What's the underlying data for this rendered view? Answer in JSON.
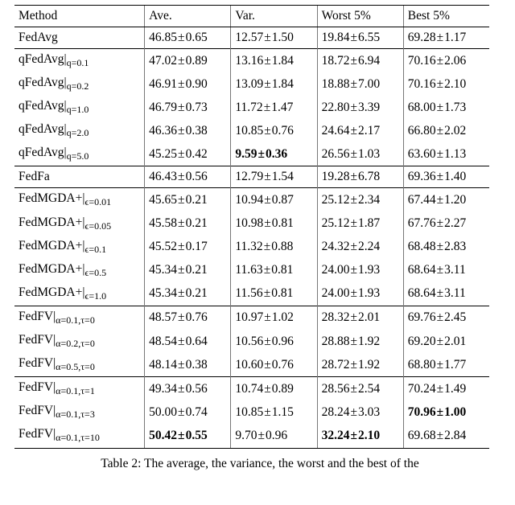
{
  "table": {
    "header": {
      "method": "Method",
      "ave": "Ave.",
      "var": "Var.",
      "worst": "Worst 5%",
      "best": "Best 5%"
    },
    "pm": "±",
    "rows": [
      {
        "method": "FedAvg",
        "sub": "",
        "ave_v": "46.85",
        "ave_e": "0.65",
        "var_v": "12.57",
        "var_e": "1.50",
        "wor_v": "19.84",
        "wor_e": "6.55",
        "bes_v": "69.28",
        "bes_e": "1.17",
        "group": "a",
        "b": []
      },
      {
        "method": "qFedAvg|",
        "sub": "q=0.1",
        "ave_v": "47.02",
        "ave_e": "0.89",
        "var_v": "13.16",
        "var_e": "1.84",
        "wor_v": "18.72",
        "wor_e": "6.94",
        "bes_v": "70.16",
        "bes_e": "2.06",
        "group": "b",
        "b": []
      },
      {
        "method": "qFedAvg|",
        "sub": "q=0.2",
        "ave_v": "46.91",
        "ave_e": "0.90",
        "var_v": "13.09",
        "var_e": "1.84",
        "wor_v": "18.88",
        "wor_e": "7.00",
        "bes_v": "70.16",
        "bes_e": "2.10",
        "group": "b",
        "b": []
      },
      {
        "method": "qFedAvg|",
        "sub": "q=1.0",
        "ave_v": "46.79",
        "ave_e": "0.73",
        "var_v": "11.72",
        "var_e": "1.47",
        "wor_v": "22.80",
        "wor_e": "3.39",
        "bes_v": "68.00",
        "bes_e": "1.73",
        "group": "b",
        "b": []
      },
      {
        "method": "qFedAvg|",
        "sub": "q=2.0",
        "ave_v": "46.36",
        "ave_e": "0.38",
        "var_v": "10.85",
        "var_e": "0.76",
        "wor_v": "24.64",
        "wor_e": "2.17",
        "bes_v": "66.80",
        "bes_e": "2.02",
        "group": "b",
        "b": []
      },
      {
        "method": "qFedAvg|",
        "sub": "q=5.0",
        "ave_v": "45.25",
        "ave_e": "0.42",
        "var_v": "9.59",
        "var_e": "0.36",
        "wor_v": "26.56",
        "wor_e": "1.03",
        "bes_v": "63.60",
        "bes_e": "1.13",
        "group": "b",
        "b": [
          "var"
        ]
      },
      {
        "method": "FedFa",
        "sub": "",
        "ave_v": "46.43",
        "ave_e": "0.56",
        "var_v": "12.79",
        "var_e": "1.54",
        "wor_v": "19.28",
        "wor_e": "6.78",
        "bes_v": "69.36",
        "bes_e": "1.40",
        "group": "c",
        "b": []
      },
      {
        "method": "FedMGDA+|",
        "sub": "ϵ=0.01",
        "ave_v": "45.65",
        "ave_e": "0.21",
        "var_v": "10.94",
        "var_e": "0.87",
        "wor_v": "25.12",
        "wor_e": "2.34",
        "bes_v": "67.44",
        "bes_e": "1.20",
        "group": "d",
        "b": []
      },
      {
        "method": "FedMGDA+|",
        "sub": "ϵ=0.05",
        "ave_v": "45.58",
        "ave_e": "0.21",
        "var_v": "10.98",
        "var_e": "0.81",
        "wor_v": "25.12",
        "wor_e": "1.87",
        "bes_v": "67.76",
        "bes_e": "2.27",
        "group": "d",
        "b": []
      },
      {
        "method": "FedMGDA+|",
        "sub": "ϵ=0.1",
        "ave_v": "45.52",
        "ave_e": "0.17",
        "var_v": "11.32",
        "var_e": "0.88",
        "wor_v": "24.32",
        "wor_e": "2.24",
        "bes_v": "68.48",
        "bes_e": "2.83",
        "group": "d",
        "b": []
      },
      {
        "method": "FedMGDA+|",
        "sub": "ϵ=0.5",
        "ave_v": "45.34",
        "ave_e": "0.21",
        "var_v": "11.63",
        "var_e": "0.81",
        "wor_v": "24.00",
        "wor_e": "1.93",
        "bes_v": "68.64",
        "bes_e": "3.11",
        "group": "d",
        "b": []
      },
      {
        "method": "FedMGDA+|",
        "sub": "ϵ=1.0",
        "ave_v": "45.34",
        "ave_e": "0.21",
        "var_v": "11.56",
        "var_e": "0.81",
        "wor_v": "24.00",
        "wor_e": "1.93",
        "bes_v": "68.64",
        "bes_e": "3.11",
        "group": "d",
        "b": []
      },
      {
        "method": "FedFV|",
        "sub": "α=0.1,τ=0",
        "ave_v": "48.57",
        "ave_e": "0.76",
        "var_v": "10.97",
        "var_e": "1.02",
        "wor_v": "28.32",
        "wor_e": "2.01",
        "bes_v": "69.76",
        "bes_e": "2.45",
        "group": "e",
        "b": []
      },
      {
        "method": "FedFV|",
        "sub": "α=0.2,τ=0",
        "ave_v": "48.54",
        "ave_e": "0.64",
        "var_v": "10.56",
        "var_e": "0.96",
        "wor_v": "28.88",
        "wor_e": "1.92",
        "bes_v": "69.20",
        "bes_e": "2.01",
        "group": "e",
        "b": []
      },
      {
        "method": "FedFV|",
        "sub": "α=0.5,τ=0",
        "ave_v": "48.14",
        "ave_e": "0.38",
        "var_v": "10.60",
        "var_e": "0.76",
        "wor_v": "28.72",
        "wor_e": "1.92",
        "bes_v": "68.80",
        "bes_e": "1.77",
        "group": "e",
        "b": []
      },
      {
        "method": "FedFV|",
        "sub": "α=0.1,τ=1",
        "ave_v": "49.34",
        "ave_e": "0.56",
        "var_v": "10.74",
        "var_e": "0.89",
        "wor_v": "28.56",
        "wor_e": "2.54",
        "bes_v": "70.24",
        "bes_e": "1.49",
        "group": "f",
        "b": []
      },
      {
        "method": "FedFV|",
        "sub": "α=0.1,τ=3",
        "ave_v": "50.00",
        "ave_e": "0.74",
        "var_v": "10.85",
        "var_e": "1.15",
        "wor_v": "28.24",
        "wor_e": "3.03",
        "bes_v": "70.96",
        "bes_e": "1.00",
        "group": "f",
        "b": [
          "bes"
        ]
      },
      {
        "method": "FedFV|",
        "sub": "α=0.1,τ=10",
        "ave_v": "50.42",
        "ave_e": "0.55",
        "var_v": "9.70",
        "var_e": "0.96",
        "wor_v": "32.24",
        "wor_e": "2.10",
        "bes_v": "69.68",
        "bes_e": "2.84",
        "group": "f",
        "b": [
          "ave",
          "wor"
        ]
      }
    ]
  },
  "caption": "Table 2: The average, the variance, the worst and the best of the",
  "chart_data": {
    "type": "table",
    "columns": [
      "Method",
      "Ave.",
      "Var.",
      "Worst 5%",
      "Best 5%"
    ],
    "data": [
      [
        "FedAvg",
        "46.85±0.65",
        "12.57±1.50",
        "19.84±6.55",
        "69.28±1.17"
      ],
      [
        "qFedAvg|q=0.1",
        "47.02±0.89",
        "13.16±1.84",
        "18.72±6.94",
        "70.16±2.06"
      ],
      [
        "qFedAvg|q=0.2",
        "46.91±0.90",
        "13.09±1.84",
        "18.88±7.00",
        "70.16±2.10"
      ],
      [
        "qFedAvg|q=1.0",
        "46.79±0.73",
        "11.72±1.47",
        "22.80±3.39",
        "68.00±1.73"
      ],
      [
        "qFedAvg|q=2.0",
        "46.36±0.38",
        "10.85±0.76",
        "24.64±2.17",
        "66.80±2.02"
      ],
      [
        "qFedAvg|q=5.0",
        "45.25±0.42",
        "9.59±0.36",
        "26.56±1.03",
        "63.60±1.13"
      ],
      [
        "FedFa",
        "46.43±0.56",
        "12.79±1.54",
        "19.28±6.78",
        "69.36±1.40"
      ],
      [
        "FedMGDA+|ϵ=0.01",
        "45.65±0.21",
        "10.94±0.87",
        "25.12±2.34",
        "67.44±1.20"
      ],
      [
        "FedMGDA+|ϵ=0.05",
        "45.58±0.21",
        "10.98±0.81",
        "25.12±1.87",
        "67.76±2.27"
      ],
      [
        "FedMGDA+|ϵ=0.1",
        "45.52±0.17",
        "11.32±0.88",
        "24.32±2.24",
        "68.48±2.83"
      ],
      [
        "FedMGDA+|ϵ=0.5",
        "45.34±0.21",
        "11.63±0.81",
        "24.00±1.93",
        "68.64±3.11"
      ],
      [
        "FedMGDA+|ϵ=1.0",
        "45.34±0.21",
        "11.56±0.81",
        "24.00±1.93",
        "68.64±3.11"
      ],
      [
        "FedFV|α=0.1,τ=0",
        "48.57±0.76",
        "10.97±1.02",
        "28.32±2.01",
        "69.76±2.45"
      ],
      [
        "FedFV|α=0.2,τ=0",
        "48.54±0.64",
        "10.56±0.96",
        "28.88±1.92",
        "69.20±2.01"
      ],
      [
        "FedFV|α=0.5,τ=0",
        "48.14±0.38",
        "10.60±0.76",
        "28.72±1.92",
        "68.80±1.77"
      ],
      [
        "FedFV|α=0.1,τ=1",
        "49.34±0.56",
        "10.74±0.89",
        "28.56±2.54",
        "70.24±1.49"
      ],
      [
        "FedFV|α=0.1,τ=3",
        "50.00±0.74",
        "10.85±1.15",
        "28.24±3.03",
        "70.96±1.00"
      ],
      [
        "FedFV|α=0.1,τ=10",
        "50.42±0.55",
        "9.70±0.96",
        "32.24±2.10",
        "69.68±2.84"
      ]
    ]
  }
}
